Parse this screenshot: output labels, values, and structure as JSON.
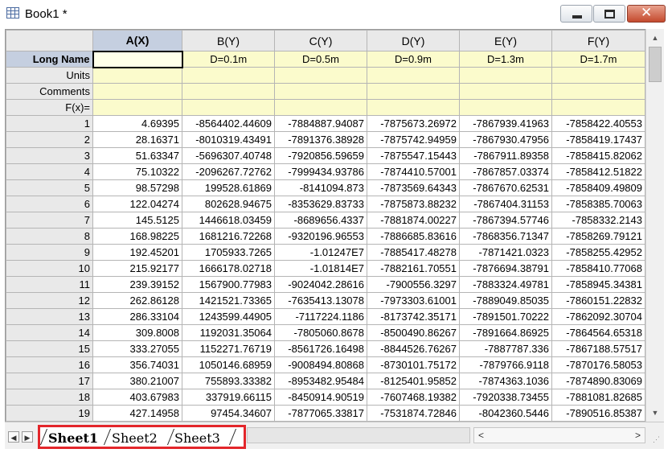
{
  "window": {
    "title": "Book1 *",
    "icon": "spreadsheet-grid-icon",
    "minimize_icon": "minimize-icon",
    "maximize_icon": "maximize-icon",
    "close_icon": "close-icon",
    "close_color": "#c44a2e"
  },
  "sheet": {
    "selected_column_color": "#c5cfe0",
    "metadata_row_color": "#fbfbcc",
    "columns": [
      "A(X)",
      "B(Y)",
      "C(Y)",
      "D(Y)",
      "E(Y)",
      "F(Y)"
    ],
    "selected_column": "A(X)",
    "meta_rows": [
      {
        "label": "Long Name",
        "values": [
          "",
          "D=0.1m",
          "D=0.5m",
          "D=0.9m",
          "D=1.3m",
          "D=1.7m"
        ]
      },
      {
        "label": "Units",
        "values": [
          "",
          "",
          "",
          "",
          "",
          ""
        ]
      },
      {
        "label": "Comments",
        "values": [
          "",
          "",
          "",
          "",
          "",
          ""
        ]
      },
      {
        "label": "F(x)=",
        "values": [
          "",
          "",
          "",
          "",
          "",
          ""
        ]
      }
    ],
    "rows": [
      {
        "n": "1",
        "cells": [
          "4.69395",
          "-8564402.44609",
          "-7884887.94087",
          "-7875673.26972",
          "-7867939.41963",
          "-7858422.40553"
        ]
      },
      {
        "n": "2",
        "cells": [
          "28.16371",
          "-8010319.43491",
          "-7891376.38928",
          "-7875742.94959",
          "-7867930.47956",
          "-7858419.17437"
        ]
      },
      {
        "n": "3",
        "cells": [
          "51.63347",
          "-5696307.40748",
          "-7920856.59659",
          "-7875547.15443",
          "-7867911.89358",
          "-7858415.82062"
        ]
      },
      {
        "n": "4",
        "cells": [
          "75.10322",
          "-2096267.72762",
          "-7999434.93786",
          "-7874410.57001",
          "-7867857.03374",
          "-7858412.51822"
        ]
      },
      {
        "n": "5",
        "cells": [
          "98.57298",
          "199528.61869",
          "-8141094.873",
          "-7873569.64343",
          "-7867670.62531",
          "-7858409.49809"
        ]
      },
      {
        "n": "6",
        "cells": [
          "122.04274",
          "802628.94675",
          "-8353629.83733",
          "-7875873.88232",
          "-7867404.31153",
          "-7858385.70063"
        ]
      },
      {
        "n": "7",
        "cells": [
          "145.5125",
          "1446618.03459",
          "-8689656.4337",
          "-7881874.00227",
          "-7867394.57746",
          "-7858332.2143"
        ]
      },
      {
        "n": "8",
        "cells": [
          "168.98225",
          "1681216.72268",
          "-9320196.96553",
          "-7886685.83616",
          "-7868356.71347",
          "-7858269.79121"
        ]
      },
      {
        "n": "9",
        "cells": [
          "192.45201",
          "1705933.7265",
          "-1.01247E7",
          "-7885417.48278",
          "-7871421.0323",
          "-7858255.42952"
        ]
      },
      {
        "n": "10",
        "cells": [
          "215.92177",
          "1666178.02718",
          "-1.01814E7",
          "-7882161.70551",
          "-7876694.38791",
          "-7858410.77068"
        ]
      },
      {
        "n": "11",
        "cells": [
          "239.39152",
          "1567900.77983",
          "-9024042.28616",
          "-7900556.3297",
          "-7883324.49781",
          "-7858945.34381"
        ]
      },
      {
        "n": "12",
        "cells": [
          "262.86128",
          "1421521.73365",
          "-7635413.13078",
          "-7973303.61001",
          "-7889049.85035",
          "-7860151.22832"
        ]
      },
      {
        "n": "13",
        "cells": [
          "286.33104",
          "1243599.44905",
          "-7117224.1186",
          "-8173742.35171",
          "-7891501.70222",
          "-7862092.30704"
        ]
      },
      {
        "n": "14",
        "cells": [
          "309.8008",
          "1192031.35064",
          "-7805060.8678",
          "-8500490.86267",
          "-7891664.86925",
          "-7864564.65318"
        ]
      },
      {
        "n": "15",
        "cells": [
          "333.27055",
          "1152271.76719",
          "-8561726.16498",
          "-8844526.76267",
          "-7887787.336",
          "-7867188.57517"
        ]
      },
      {
        "n": "16",
        "cells": [
          "356.74031",
          "1050146.68959",
          "-9008494.80868",
          "-8730101.75172",
          "-7879766.9118",
          "-7870176.58053"
        ]
      },
      {
        "n": "17",
        "cells": [
          "380.21007",
          "755893.33382",
          "-8953482.95484",
          "-8125401.95852",
          "-7874363.1036",
          "-7874890.83069"
        ]
      },
      {
        "n": "18",
        "cells": [
          "403.67983",
          "337919.66115",
          "-8450914.90519",
          "-7607468.19382",
          "-7920338.73455",
          "-7881081.82685"
        ]
      },
      {
        "n": "19",
        "cells": [
          "427.14958",
          "97454.34607",
          "-7877065.33817",
          "-7531874.72846",
          "-8042360.5446",
          "-7890516.85387"
        ]
      }
    ]
  },
  "tabs": {
    "items": [
      "Sheet1",
      "Sheet2",
      "Sheet3"
    ],
    "active": "Sheet1",
    "highlight_color": "#e3262b"
  },
  "scroll": {
    "first_icon": "nav-first-icon",
    "prev_icon": "nav-prev-icon",
    "left_icon": "scroll-left-icon",
    "right_icon": "scroll-right-icon",
    "up_icon": "scroll-up-icon",
    "down_icon": "scroll-down-icon",
    "grip_icon": "resize-grip-icon"
  }
}
